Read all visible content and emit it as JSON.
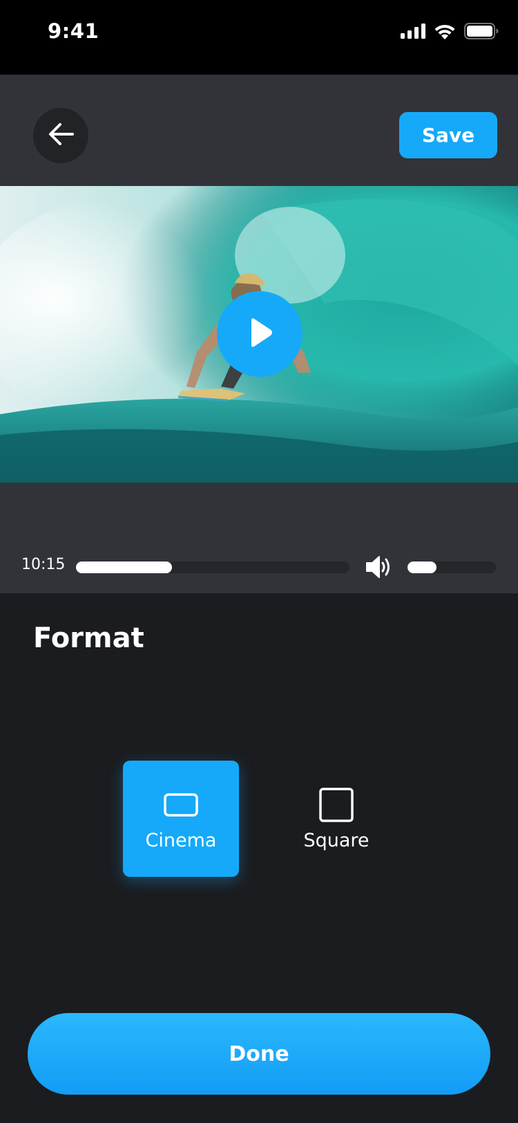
{
  "status_bar": {
    "time": "9:41",
    "icons": [
      "signal-icon",
      "wifi-icon",
      "battery-icon"
    ]
  },
  "header": {
    "back_icon": "arrow-left-icon",
    "save_label": "Save"
  },
  "video": {
    "play_icon": "play-icon"
  },
  "player": {
    "time": "10:15",
    "progress": 0.35,
    "volume_icon": "speaker-icon",
    "volume": 0.33
  },
  "format": {
    "title": "Format",
    "options": [
      {
        "label": "Cinema",
        "icon": "rectangle-icon",
        "selected": true
      },
      {
        "label": "Square",
        "icon": "square-icon",
        "selected": false
      }
    ]
  },
  "done_label": "Done",
  "colors": {
    "accent": "#16a9f9",
    "background": "#1b1c1f",
    "panel": "#323338"
  }
}
